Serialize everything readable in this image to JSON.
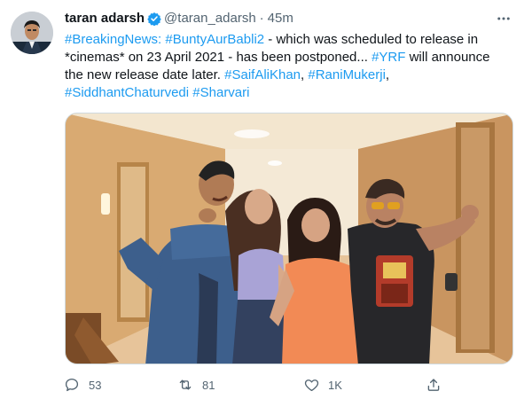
{
  "tweet": {
    "display_name": "taran adarsh",
    "verified": true,
    "handle": "@taran_adarsh",
    "separator": "·",
    "time": "45m",
    "text_parts": [
      {
        "text": "#BreakingNews:",
        "hashtag": true
      },
      {
        "text": " ",
        "hashtag": false
      },
      {
        "text": "#BuntyAurBabli2",
        "hashtag": true
      },
      {
        "text": " - which was scheduled to release in *cinemas* on 23 April 2021 - has been postponed... ",
        "hashtag": false
      },
      {
        "text": "#YRF",
        "hashtag": true
      },
      {
        "text": " will announce the new release date later. ",
        "hashtag": false
      },
      {
        "text": "#SaifAliKhan",
        "hashtag": true
      },
      {
        "text": ", ",
        "hashtag": false
      },
      {
        "text": "#RaniMukerji",
        "hashtag": true
      },
      {
        "text": ", ",
        "hashtag": false
      },
      {
        "text": "#SiddhantChaturvedi",
        "hashtag": true
      },
      {
        "text": " ",
        "hashtag": false
      },
      {
        "text": "#Sharvari",
        "hashtag": true
      }
    ],
    "actions": {
      "reply_count": "53",
      "retweet_count": "81",
      "like_count": "1K"
    }
  },
  "icons": {
    "verified": "verified-badge-icon",
    "more": "more-icon",
    "reply": "reply-icon",
    "retweet": "retweet-icon",
    "like": "heart-icon",
    "share": "share-icon"
  },
  "colors": {
    "hashtag": "#1d9bf0",
    "secondary_text": "#536471",
    "primary_text": "#0f1419",
    "verified": "#1d9bf0"
  }
}
